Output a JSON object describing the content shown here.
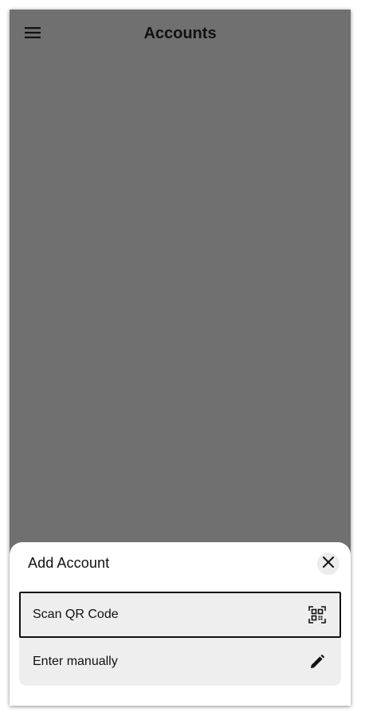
{
  "app_bar": {
    "title": "Accounts",
    "menu_icon": "hamburger-menu-icon"
  },
  "sheet": {
    "title": "Add Account",
    "close_icon": "close-icon",
    "options": [
      {
        "label": "Scan QR Code",
        "icon": "qr-code-scan-icon",
        "selected": true
      },
      {
        "label": "Enter manually",
        "icon": "pencil-icon",
        "selected": false
      }
    ]
  },
  "colors": {
    "scrim": "#707070",
    "sheet_background": "#ffffff",
    "option_background": "#eeeeee",
    "text": "#111111"
  }
}
